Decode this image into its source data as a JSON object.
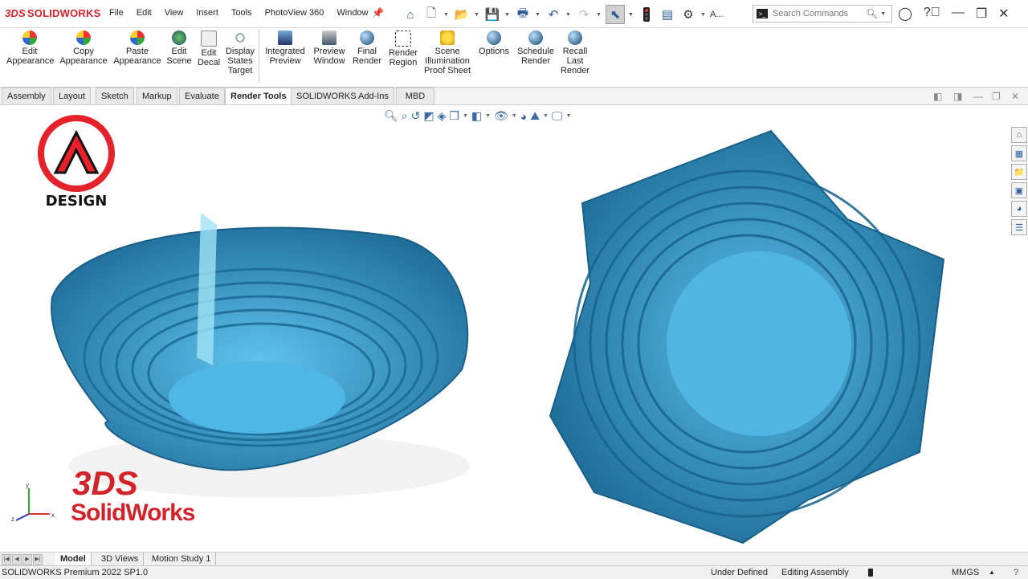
{
  "app": {
    "logo_mark": "3DS",
    "logo_text": "SOLIDWORKS"
  },
  "menu": [
    "File",
    "Edit",
    "View",
    "Insert",
    "Tools",
    "PhotoView 360",
    "Window"
  ],
  "search": {
    "placeholder": "Search Commands"
  },
  "quick_icons": [
    "home-icon",
    "new-doc-icon",
    "open-icon",
    "save-icon",
    "print-icon",
    "undo-icon",
    "redo-icon",
    "select-icon",
    "traffic-light-icon",
    "file-props-icon",
    "options-gear-icon"
  ],
  "quick_more": "A...",
  "ribbon": [
    {
      "l1": "Edit",
      "l2": "Appearance",
      "l3": ""
    },
    {
      "l1": "Copy",
      "l2": "Appearance",
      "l3": ""
    },
    {
      "l1": "Paste",
      "l2": "Appearance",
      "l3": ""
    },
    {
      "l1": "Edit",
      "l2": "Scene",
      "l3": ""
    },
    {
      "l1": "Edit",
      "l2": "Decal",
      "l3": ""
    },
    {
      "l1": "Display",
      "l2": "States",
      "l3": "Target"
    },
    {
      "l1": "Integrated",
      "l2": "Preview",
      "l3": ""
    },
    {
      "l1": "Preview",
      "l2": "Window",
      "l3": ""
    },
    {
      "l1": "Final",
      "l2": "Render",
      "l3": ""
    },
    {
      "l1": "Render",
      "l2": "Region",
      "l3": ""
    },
    {
      "l1": "Scene",
      "l2": "Illumination",
      "l3": "Proof Sheet"
    },
    {
      "l1": "Options",
      "l2": "",
      "l3": ""
    },
    {
      "l1": "Schedule",
      "l2": "Render",
      "l3": ""
    },
    {
      "l1": "Recall",
      "l2": "Last",
      "l3": "Render"
    }
  ],
  "tabs": [
    "Assembly",
    "Layout",
    "Sketch",
    "Markup",
    "Evaluate",
    "Render Tools",
    "SOLIDWORKS Add-Ins",
    "MBD"
  ],
  "active_tab": "Render Tools",
  "brand": {
    "text": "DESIGN",
    "sw_mark": "3DS",
    "sw_word": "SolidWorks"
  },
  "triad": {
    "x": "x",
    "y": "y",
    "z": "z"
  },
  "bottom_tabs": [
    "Model",
    "3D Views",
    "Motion Study 1"
  ],
  "status": {
    "product": "SOLIDWORKS Premium 2022 SP1.0",
    "state": "Under Defined",
    "mode": "Editing Assembly",
    "units": "MMGS"
  },
  "colors": {
    "accent": "#d2232a",
    "model": "#2f8fc0",
    "model_light": "#5fc3ec"
  }
}
